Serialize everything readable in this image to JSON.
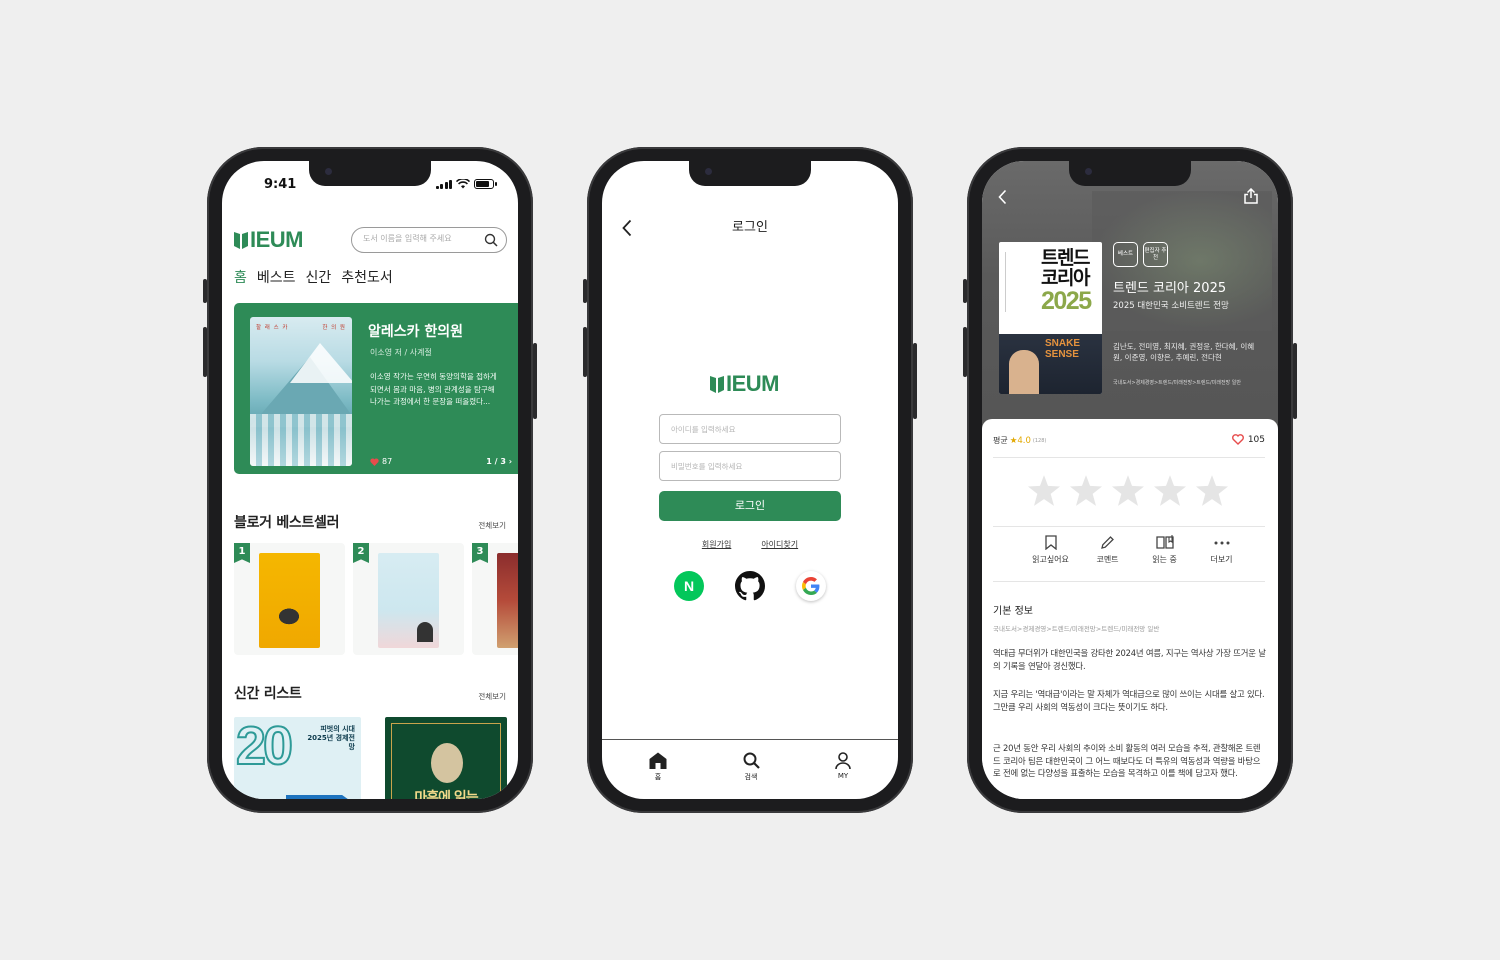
{
  "colors": {
    "brand_green": "#2e8b57",
    "background": "#efefef",
    "star_gold": "#e2a800",
    "heart_red": "#e74c4c"
  },
  "app": {
    "logo": "IEUM"
  },
  "home": {
    "status_time": "9:41",
    "search_placeholder": "도서 이름을 입력해 주세요",
    "categories": [
      "홈",
      "베스트",
      "신간",
      "추천도서"
    ],
    "hero": {
      "cover_title_left": "할 래 스 카",
      "cover_title_right": "한 의 원",
      "title": "알레스카 한의원",
      "author": "이소영 저 / 사계절",
      "description": "이소영 작가는 우연히 동양의학을 접하게 되면서 몸과 마음, 병의 관계성을 탐구해 나가는 과정에서 한 문장을 떠올렸다...",
      "likes": "87",
      "page": "1 / 3"
    },
    "bestseller": {
      "title": "블로거 베스트셀러",
      "more": "전체보기",
      "ranks": [
        "1",
        "2",
        "3"
      ]
    },
    "new_books": {
      "title": "신간 리스트",
      "more": "전체보기",
      "book1_big": "20",
      "book1_title": "피벗의 시대 2025년 경제전망",
      "book2_title": "마흔에 읽는"
    }
  },
  "login": {
    "title": "로그인",
    "id_placeholder": "아이디를 입력하세요",
    "pw_placeholder": "비밀번호를 입력하세요",
    "login_button": "로그인",
    "signup": "회원가입",
    "find_id": "아이디찾기",
    "naver": "N",
    "tabs": [
      "홈",
      "검색",
      "MY"
    ]
  },
  "detail": {
    "badges": [
      "베스트",
      "편집자 추천"
    ],
    "cover_title": "트렌드 코리아",
    "cover_year": "2025",
    "cover_snake": "SNAKE SENSE",
    "title": "트렌드 코리아 2025",
    "subtitle": "2025 대한민국 소비트렌드 전망",
    "authors": "김난도, 전미영, 최지혜, 권정윤, 한다혜, 이혜원, 이준영, 이향은, 추예린, 전다현",
    "category_top": "국내도서>경제경영>트렌드/미래전망>트렌드/미래전망 일반",
    "avg_label": "평균",
    "avg_value": "★4.0",
    "rating_count": "(128)",
    "likes": "105",
    "actions": [
      "읽고싶어요",
      "코멘트",
      "읽는 중",
      "더보기"
    ],
    "info_title": "기본 정보",
    "info_category": "국내도서>경제경영>트렌드/미래전망>트렌드/미래전망 일반",
    "paragraphs": [
      "역대급 무더위가 대한민국을 강타한 2024년 여름, 지구는 역사상 가장 뜨거운 날의 기록을 연달아 경신했다.",
      "지금 우리는 '역대급'이라는 말 자체가 역대급으로 많이 쓰이는 시대를 살고 있다. 그만큼 우리 사회의 역동성이 크다는 뜻이기도 하다.",
      "근 20년 동안 우리 사회의 추이와 소비 활동의 여러 모습을 추적, 관찰해온 트렌드 코리아 팀은 대한민국이 그 어느 때보다도 더 특유의 역동성과 역량을 바탕으로 전에 없는 다양성을 표출하는 모습을 목격하고 이를 책에 담고자 했다."
    ]
  }
}
